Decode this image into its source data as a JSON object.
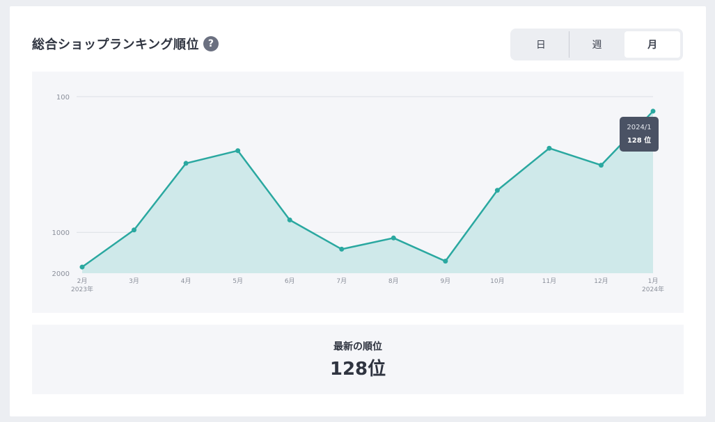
{
  "header": {
    "title": "総合ショップランキング順位",
    "help_glyph": "?"
  },
  "toggle": {
    "options": [
      "日",
      "週",
      "月"
    ],
    "selected": "月"
  },
  "summary": {
    "label": "最新の順位",
    "value": "128位"
  },
  "tooltip": {
    "date": "2024/1",
    "value": "128 位"
  },
  "colors": {
    "line": "#2aa8a0",
    "area": "#cfe9ea",
    "tooltip_bg": "#4a5264"
  },
  "chart_data": {
    "type": "area",
    "x": [
      "2023-02",
      "2023-03",
      "2023-04",
      "2023-05",
      "2023-06",
      "2023-07",
      "2023-08",
      "2023-09",
      "2023-10",
      "2023-11",
      "2023-12",
      "2024-01"
    ],
    "x_tick_labels": [
      "2月",
      "3月",
      "4月",
      "5月",
      "6月",
      "7月",
      "8月",
      "9月",
      "10月",
      "11月",
      "12月",
      "1月"
    ],
    "x_year_labels": {
      "0": "2023年",
      "11": "2024年"
    },
    "values": [
      1800,
      960,
      310,
      250,
      810,
      1330,
      1100,
      1630,
      490,
      240,
      320,
      128
    ],
    "y_ticks": [
      100,
      1000,
      2000
    ],
    "y_scale": "log",
    "y_inverted": true,
    "ylim": [
      100,
      2000
    ],
    "grid": true,
    "tooltip_index": 11
  }
}
